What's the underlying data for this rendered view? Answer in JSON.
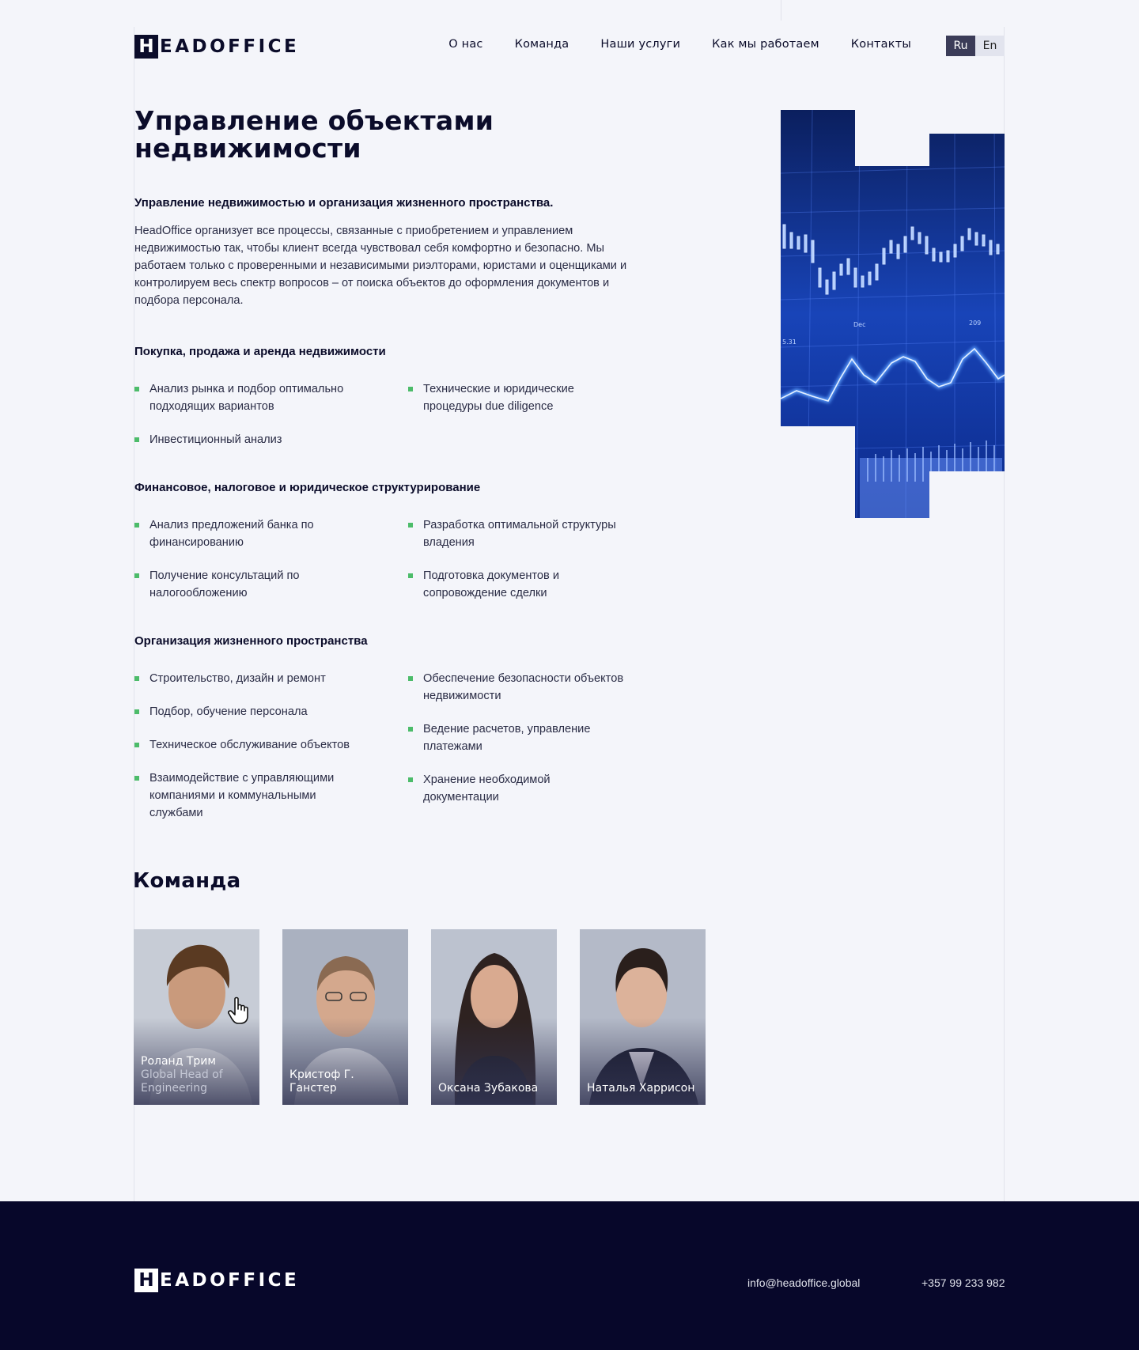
{
  "header": {
    "logo_initial": "H",
    "logo_rest": "EADOFFICE",
    "nav": [
      "О нас",
      "Команда",
      "Наши услуги",
      "Как мы работаем",
      "Контакты"
    ],
    "lang": {
      "ru": "Ru",
      "en": "En",
      "active": "Ru"
    }
  },
  "main": {
    "title": "Управление объектами недвижимости",
    "lead": "Управление недвижимостью и организация жизненного пространства.",
    "intro": "HeadOffice организует все процессы, связанные с приобретением и управлением недвижимостью так, чтобы клиент всегда чувствовал себя комфортно и безопасно. Мы работаем только с проверенными и независимыми риэлторами, юристами и оценщиками и контролируем весь спектр вопросов – от поиска объектов до оформления документов и подбора персонала.",
    "sections": [
      {
        "title": "Покупка, продажа и аренда недвижимости",
        "left": [
          "Анализ рынка и подбор оптимально подходящих вариантов",
          "Инвестиционный анализ"
        ],
        "right": [
          "Технические и юридические процедуры due diligence"
        ]
      },
      {
        "title": "Финансовое, налоговое и юридическое структурирование",
        "left": [
          "Анализ предложений банка по финансированию",
          "Получение консультаций по налогообложению"
        ],
        "right": [
          "Разработка оптимальной структуры владения",
          "Подготовка документов и сопровождение сделки"
        ]
      },
      {
        "title": "Организация жизненного пространства",
        "left": [
          "Строительство, дизайн и ремонт",
          "Подбор, обучение персонала",
          "Техническое обслуживание объектов",
          "Взаимодействие с управляющими компаниями и коммунальными службами"
        ],
        "right": [
          "Обеспечение безопасности объектов недвижимости",
          "Ведение расчетов, управление платежами",
          "Хранение необходимой документации"
        ]
      }
    ],
    "chart_image_labels": {
      "month": "Dec",
      "year": "209",
      "price": "5.31"
    }
  },
  "team": {
    "title": "Команда",
    "members": [
      {
        "name": "Роланд Трим",
        "role": "Global Head of Engineering"
      },
      {
        "name": "Кристоф Г. Ганстер",
        "role": ""
      },
      {
        "name": "Оксана Зубакова",
        "role": ""
      },
      {
        "name": "Наталья Харрисон",
        "role": ""
      }
    ]
  },
  "footer": {
    "email": "info@headoffice.global",
    "phone": "+357 99 233 982"
  },
  "colors": {
    "navy": "#0b0c2a",
    "footer_bg": "#07072a",
    "bullet_green": "#4cbc6a",
    "page_bg": "#f4f5fa"
  }
}
